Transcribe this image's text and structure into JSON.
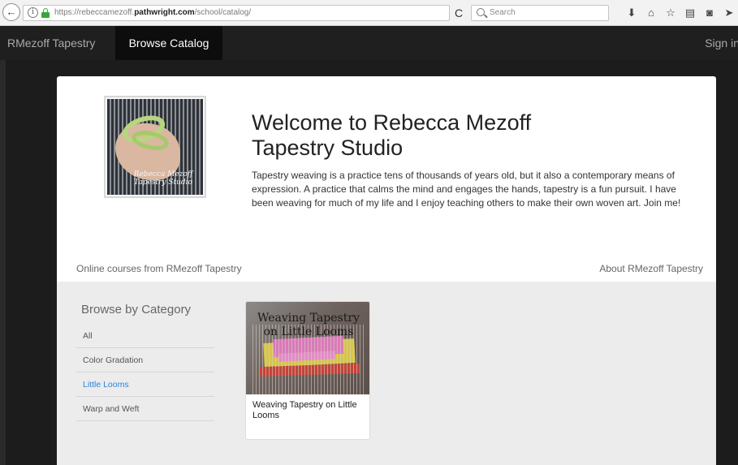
{
  "browser": {
    "url_prefix": "https://rebeccamezoff.",
    "url_domain": "pathwright.com",
    "url_path": "/school/catalog/",
    "search_placeholder": "Search",
    "back_glyph": "←",
    "info_glyph": "i",
    "reload_glyph": "C",
    "toolbar_icons": [
      {
        "name": "download-icon",
        "glyph": "⬇"
      },
      {
        "name": "home-icon",
        "glyph": "⌂"
      },
      {
        "name": "bookmark-star-icon",
        "glyph": "☆"
      },
      {
        "name": "reader-view-icon",
        "glyph": "▤"
      },
      {
        "name": "pocket-icon",
        "glyph": "◙"
      },
      {
        "name": "send-icon",
        "glyph": "➤"
      }
    ]
  },
  "site_nav": {
    "brand": "RMezoff Tapestry",
    "active_tab": "Browse Catalog",
    "sign_in": "Sign in"
  },
  "hero": {
    "logo_text_line1": "Rebecca Mezoff",
    "logo_text_line2": "Tapestry Studio",
    "title_line1": "Welcome to Rebecca Mezoff",
    "title_line2": "Tapestry Studio",
    "intro": "Tapestry weaving is a practice tens of thousands of years old, but it also a contemporary means of expression. A practice that calms the mind and engages the hands, tapestry is a fun pursuit. I have been weaving for much of my life and I enjoy teaching others to make their own woven art. Join me!"
  },
  "subheader": {
    "tagline": "Online courses from RMezoff Tapestry",
    "about_link": "About RMezoff Tapestry"
  },
  "catalog": {
    "heading": "Browse by Category",
    "categories": [
      {
        "label": "All",
        "active": false
      },
      {
        "label": "Color Gradation",
        "active": false
      },
      {
        "label": "Little Looms",
        "active": true
      },
      {
        "label": "Warp and Weft",
        "active": false
      }
    ],
    "courses": [
      {
        "thumb_title_line1": "Weaving Tapestry",
        "thumb_title_line2": "on Little Looms",
        "name": "Weaving Tapestry on Little Looms"
      }
    ]
  },
  "colors": {
    "nav_bg": "#1f1f1f",
    "active_category": "#2a84d8",
    "catalog_bg": "#ececec"
  }
}
